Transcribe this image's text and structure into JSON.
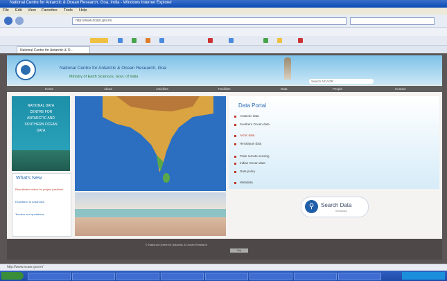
{
  "browser": {
    "window_title": "National Centre for Antarctic & Ocean Research, Goa, India - Windows Internet Explorer",
    "menu": [
      "File",
      "Edit",
      "View",
      "Favorites",
      "Tools",
      "Help"
    ],
    "url": "http://www.ncaor.gov.in/",
    "tab_label": "National Centre for Antarctic & O...",
    "status_text": "http://www.ncaor.gov.in/"
  },
  "site": {
    "title": "National Centre for Antarctic & Ocean Research, Goa",
    "subtitle": "Ministry of Earth Sciences, Govt. of India",
    "search_placeholder": "Search NCAOR",
    "nav": [
      "Home",
      "About",
      "Activities",
      "Facilities",
      "Data",
      "People",
      "Contact"
    ],
    "promo_lines": [
      "NATIONAL DATA",
      "CENTRE FOR",
      "ANTARCTIC AND",
      "SOUTHERN OCEAN",
      "DATA"
    ],
    "whats_new_title": "What's New",
    "whats_new_items": [
      "Recruitment notice for project positions",
      "Expedition to Antarctica",
      "Tenders and quotations"
    ],
    "right_title": "Data Portal",
    "right_items": [
      "Antarctic data",
      "Southern Ocean data",
      "Arctic data",
      "Himalayan data",
      "Polar remote sensing",
      "Indian Ocean data",
      "Data policy",
      "Metadata"
    ],
    "search_button": "Search Data",
    "search_sub": "metadata",
    "footer_text": "© National Centre for Antarctic & Ocean Research",
    "footer_button": "Top"
  },
  "colors": {
    "header": "#7ec1e8",
    "nav": "#5e5e5e",
    "accent": "#2a6db5"
  }
}
